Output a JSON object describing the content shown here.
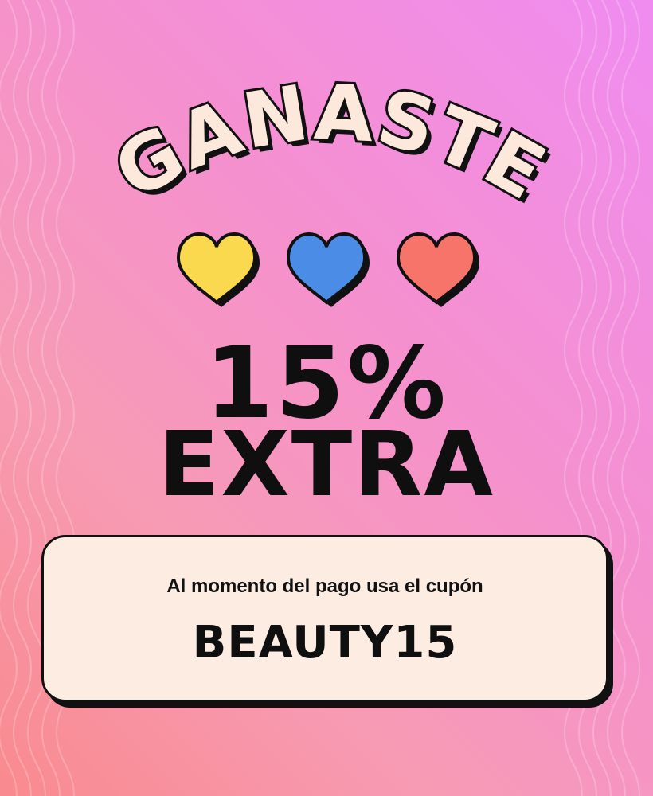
{
  "banner": {
    "headline": "GANASTE",
    "discount": "15%",
    "discount_label": "EXTRA",
    "instruction": "Al momento del pago usa el cupón",
    "coupon_code": "BEAUTY15"
  },
  "hearts": [
    {
      "name": "yellow-heart-icon",
      "color": "#fbd94f"
    },
    {
      "name": "blue-heart-icon",
      "color": "#4b8de6"
    },
    {
      "name": "coral-heart-icon",
      "color": "#f7746a"
    }
  ],
  "colors": {
    "headline_fill": "#fde9dc",
    "outline": "#111111",
    "coupon_background": "#fdece1",
    "text": "#0f0f0f"
  }
}
